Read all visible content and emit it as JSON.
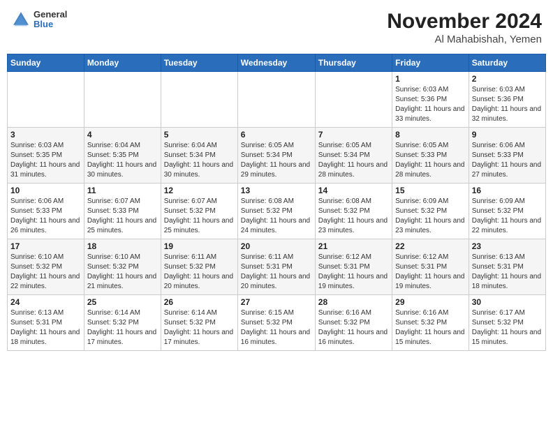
{
  "header": {
    "logo_line1": "General",
    "logo_line2": "Blue",
    "title": "November 2024",
    "subtitle": "Al Mahabishah, Yemen"
  },
  "days_of_week": [
    "Sunday",
    "Monday",
    "Tuesday",
    "Wednesday",
    "Thursday",
    "Friday",
    "Saturday"
  ],
  "weeks": [
    [
      {
        "day": "",
        "info": ""
      },
      {
        "day": "",
        "info": ""
      },
      {
        "day": "",
        "info": ""
      },
      {
        "day": "",
        "info": ""
      },
      {
        "day": "",
        "info": ""
      },
      {
        "day": "1",
        "info": "Sunrise: 6:03 AM\nSunset: 5:36 PM\nDaylight: 11 hours and 33 minutes."
      },
      {
        "day": "2",
        "info": "Sunrise: 6:03 AM\nSunset: 5:36 PM\nDaylight: 11 hours and 32 minutes."
      }
    ],
    [
      {
        "day": "3",
        "info": "Sunrise: 6:03 AM\nSunset: 5:35 PM\nDaylight: 11 hours and 31 minutes."
      },
      {
        "day": "4",
        "info": "Sunrise: 6:04 AM\nSunset: 5:35 PM\nDaylight: 11 hours and 30 minutes."
      },
      {
        "day": "5",
        "info": "Sunrise: 6:04 AM\nSunset: 5:34 PM\nDaylight: 11 hours and 30 minutes."
      },
      {
        "day": "6",
        "info": "Sunrise: 6:05 AM\nSunset: 5:34 PM\nDaylight: 11 hours and 29 minutes."
      },
      {
        "day": "7",
        "info": "Sunrise: 6:05 AM\nSunset: 5:34 PM\nDaylight: 11 hours and 28 minutes."
      },
      {
        "day": "8",
        "info": "Sunrise: 6:05 AM\nSunset: 5:33 PM\nDaylight: 11 hours and 28 minutes."
      },
      {
        "day": "9",
        "info": "Sunrise: 6:06 AM\nSunset: 5:33 PM\nDaylight: 11 hours and 27 minutes."
      }
    ],
    [
      {
        "day": "10",
        "info": "Sunrise: 6:06 AM\nSunset: 5:33 PM\nDaylight: 11 hours and 26 minutes."
      },
      {
        "day": "11",
        "info": "Sunrise: 6:07 AM\nSunset: 5:33 PM\nDaylight: 11 hours and 25 minutes."
      },
      {
        "day": "12",
        "info": "Sunrise: 6:07 AM\nSunset: 5:32 PM\nDaylight: 11 hours and 25 minutes."
      },
      {
        "day": "13",
        "info": "Sunrise: 6:08 AM\nSunset: 5:32 PM\nDaylight: 11 hours and 24 minutes."
      },
      {
        "day": "14",
        "info": "Sunrise: 6:08 AM\nSunset: 5:32 PM\nDaylight: 11 hours and 23 minutes."
      },
      {
        "day": "15",
        "info": "Sunrise: 6:09 AM\nSunset: 5:32 PM\nDaylight: 11 hours and 23 minutes."
      },
      {
        "day": "16",
        "info": "Sunrise: 6:09 AM\nSunset: 5:32 PM\nDaylight: 11 hours and 22 minutes."
      }
    ],
    [
      {
        "day": "17",
        "info": "Sunrise: 6:10 AM\nSunset: 5:32 PM\nDaylight: 11 hours and 22 minutes."
      },
      {
        "day": "18",
        "info": "Sunrise: 6:10 AM\nSunset: 5:32 PM\nDaylight: 11 hours and 21 minutes."
      },
      {
        "day": "19",
        "info": "Sunrise: 6:11 AM\nSunset: 5:32 PM\nDaylight: 11 hours and 20 minutes."
      },
      {
        "day": "20",
        "info": "Sunrise: 6:11 AM\nSunset: 5:31 PM\nDaylight: 11 hours and 20 minutes."
      },
      {
        "day": "21",
        "info": "Sunrise: 6:12 AM\nSunset: 5:31 PM\nDaylight: 11 hours and 19 minutes."
      },
      {
        "day": "22",
        "info": "Sunrise: 6:12 AM\nSunset: 5:31 PM\nDaylight: 11 hours and 19 minutes."
      },
      {
        "day": "23",
        "info": "Sunrise: 6:13 AM\nSunset: 5:31 PM\nDaylight: 11 hours and 18 minutes."
      }
    ],
    [
      {
        "day": "24",
        "info": "Sunrise: 6:13 AM\nSunset: 5:31 PM\nDaylight: 11 hours and 18 minutes."
      },
      {
        "day": "25",
        "info": "Sunrise: 6:14 AM\nSunset: 5:32 PM\nDaylight: 11 hours and 17 minutes."
      },
      {
        "day": "26",
        "info": "Sunrise: 6:14 AM\nSunset: 5:32 PM\nDaylight: 11 hours and 17 minutes."
      },
      {
        "day": "27",
        "info": "Sunrise: 6:15 AM\nSunset: 5:32 PM\nDaylight: 11 hours and 16 minutes."
      },
      {
        "day": "28",
        "info": "Sunrise: 6:16 AM\nSunset: 5:32 PM\nDaylight: 11 hours and 16 minutes."
      },
      {
        "day": "29",
        "info": "Sunrise: 6:16 AM\nSunset: 5:32 PM\nDaylight: 11 hours and 15 minutes."
      },
      {
        "day": "30",
        "info": "Sunrise: 6:17 AM\nSunset: 5:32 PM\nDaylight: 11 hours and 15 minutes."
      }
    ]
  ]
}
